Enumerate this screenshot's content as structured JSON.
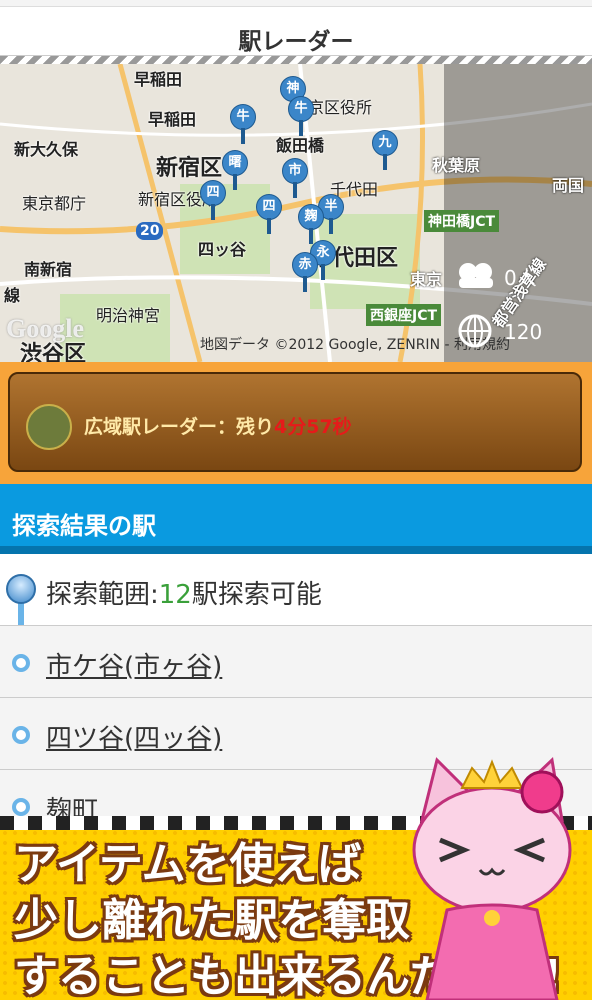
{
  "header": {
    "title": "駅レーダー"
  },
  "map": {
    "labels": {
      "waseda1": "早稲田",
      "waseda2": "早稲田",
      "bunkyo": "文京区役所",
      "iidabashi": "飯田橋",
      "shinookubo": "新大久保",
      "shinjuku_ku": "新宿区",
      "akihabara": "秋葉原",
      "tocho": "東京都庁",
      "shinjuku_kuyakusho": "新宿区役所",
      "chiyoda_office": "千代田",
      "ryogoku": "両国",
      "kandabashi": "神田橋JCT",
      "route20": "20",
      "yotsuya": "四ッ谷",
      "chiyoda_ku": "千代田区",
      "minamishinjuku": "南新宿",
      "tokyo": "東京",
      "meiji": "明治神宮",
      "nishiginza": "西銀座JCT",
      "shibuya": "渋谷区",
      "sen": "線",
      "toei": "都営浅草線",
      "copyright": "地図データ ©2012 Google, ZENRIN - 利用規約",
      "google": "Google"
    },
    "pins": [
      {
        "text": "神",
        "name": "pin-kami"
      },
      {
        "text": "牛",
        "name": "pin-ushi1"
      },
      {
        "text": "牛",
        "name": "pin-ushi2"
      },
      {
        "text": "九",
        "name": "pin-kyu"
      },
      {
        "text": "曙",
        "name": "pin-akebono"
      },
      {
        "text": "市",
        "name": "pin-ichi"
      },
      {
        "text": "四",
        "name": "pin-yon1"
      },
      {
        "text": "四",
        "name": "pin-yon2"
      },
      {
        "text": "半",
        "name": "pin-han"
      },
      {
        "text": "麹",
        "name": "pin-koji"
      },
      {
        "text": "永",
        "name": "pin-naga"
      },
      {
        "text": "赤",
        "name": "pin-aka"
      }
    ],
    "players": "0人",
    "stations": "120"
  },
  "radar": {
    "label": "広域駅レーダー：残り",
    "time": "4分57秒"
  },
  "section": {
    "title": "探索結果の駅"
  },
  "results": {
    "range_prefix": "探索範囲:",
    "range_count": "12",
    "range_suffix": "駅探索可能",
    "stations": [
      "市ケ谷(市ヶ谷)",
      "四ツ谷(四ッ谷)",
      "麹町"
    ]
  },
  "promo": {
    "line1": "アイテムを使えば",
    "line2": "少し離れた駅を奪取",
    "line3": "することも出来るんだニャ!"
  },
  "colors": {
    "accent": "#0a9ae0",
    "radar_time": "#e61a1a",
    "promo_bg": "#ffd000"
  }
}
